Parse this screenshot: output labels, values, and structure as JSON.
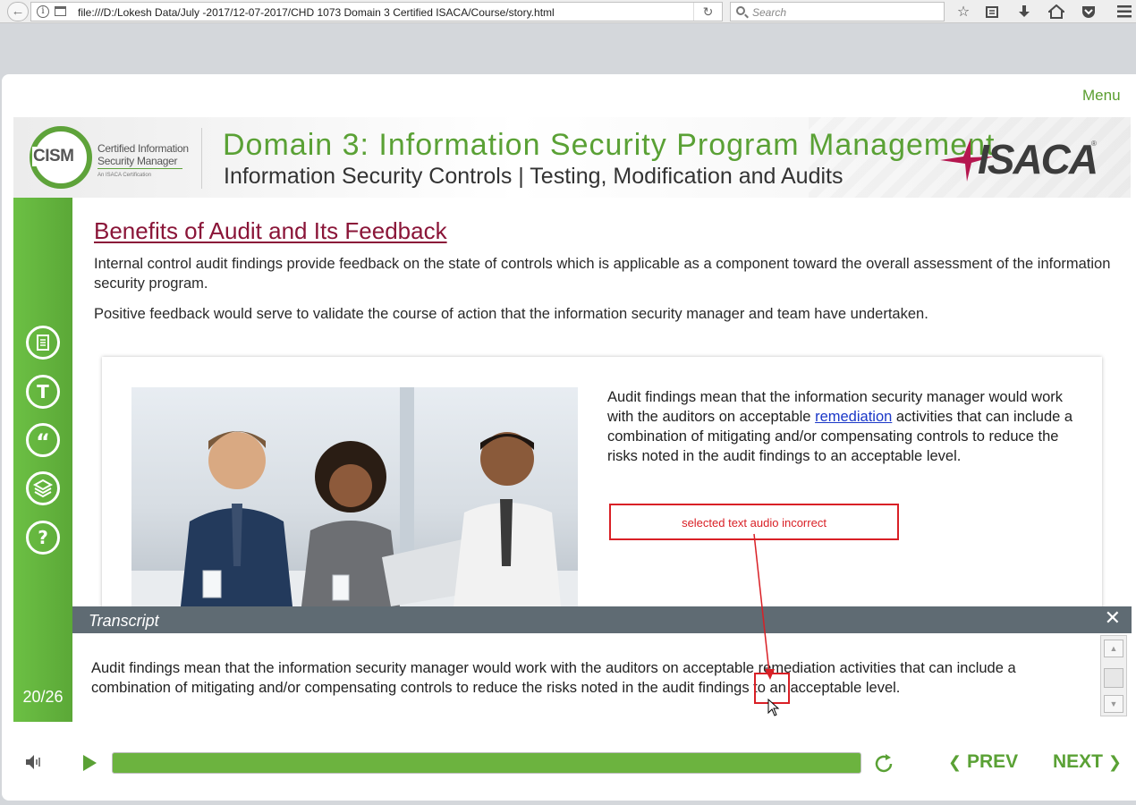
{
  "browser": {
    "url": "file:///D:/Lokesh Data/July -2017/12-07-2017/CHD 1073 Domain 3 Certified ISACA/Course/story.html",
    "search_placeholder": "Search",
    "icons": [
      "back-icon",
      "info-icon",
      "page-icon",
      "reload-icon",
      "search-icon",
      "bookmark-star-icon",
      "reading-list-icon",
      "download-icon",
      "home-icon",
      "pocket-icon",
      "hamburger-menu-icon"
    ]
  },
  "player": {
    "menu_label": "Menu",
    "slide_counter": "20/26",
    "accent_color": "#5aa135",
    "title_color": "#8a1538"
  },
  "header": {
    "logo_word": "CISM",
    "logo_line1": "Certified Information",
    "logo_line2": "Security Manager",
    "logo_line3": "An ISACA Certification",
    "domain_title": "Domain 3: Information Security Program Management",
    "subtitle": "Information Security Controls | Testing, Modification and Audits",
    "brand": "ISACA",
    "brand_mark": "®"
  },
  "sidebar": {
    "items": [
      {
        "name": "notes-icon"
      },
      {
        "name": "text-t-icon"
      },
      {
        "name": "quote-icon"
      },
      {
        "name": "layers-icon"
      },
      {
        "name": "help-icon"
      }
    ]
  },
  "content": {
    "title": "Benefits of Audit and Its Feedback",
    "paragraph1": "Internal control audit findings provide feedback on the state of controls which is applicable as a component toward the overall assessment of the information security program.",
    "paragraph2": "Positive feedback would serve to validate the course of action that the information security manager and team have undertaken.",
    "card_text_before": "Audit findings mean that the information security manager would work with the auditors on acceptable ",
    "card_link": "remediation",
    "card_text_after": " activities that can include a combination of mitigating and/or compensating controls to reduce the risks noted in the audit findings to an acceptable level."
  },
  "annotation": {
    "text": "selected text audio incorrect",
    "color": "#d92026"
  },
  "transcript": {
    "title": "Transcript",
    "close_glyph": "✕",
    "text": "Audit findings mean that the information security manager would work with the auditors on acceptable remediation activities that can include a combination of mitigating and/or compensating controls to reduce the risks noted in the audit findings to an acceptable level."
  },
  "controls": {
    "prev_label": "PREV",
    "next_label": "NEXT",
    "progress_fraction": 1.0
  }
}
